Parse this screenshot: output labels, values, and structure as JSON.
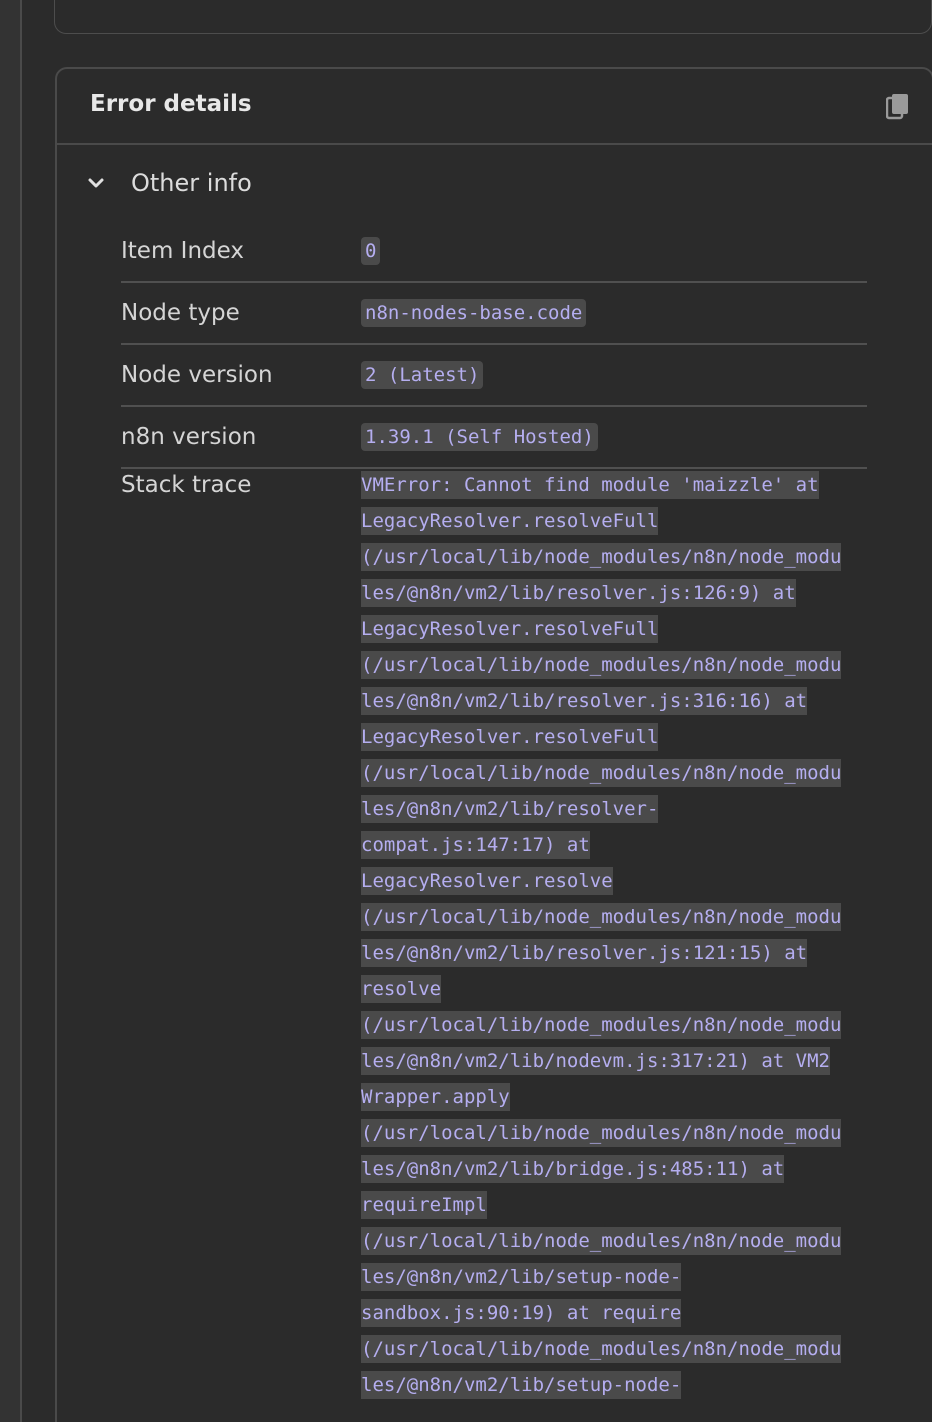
{
  "panel": {
    "title": "Error details",
    "copy_icon": "copy-icon",
    "section": {
      "label": "Other info",
      "chevron_icon": "chevron-down-icon"
    },
    "rows": [
      {
        "key": "Item Index",
        "value": "0"
      },
      {
        "key": "Node type",
        "value": "n8n-nodes-base.code"
      },
      {
        "key": "Node version",
        "value": "2 (Latest)"
      },
      {
        "key": "n8n version",
        "value": "1.39.1 (Self Hosted)"
      }
    ],
    "stack_label": "Stack trace",
    "stack_lines": [
      "VMError: Cannot find module 'maizzle' at",
      "LegacyResolver.resolveFull",
      "(/usr/local/lib/node_modules/n8n/node_modu",
      "les/@n8n/vm2/lib/resolver.js:126:9) at",
      "LegacyResolver.resolveFull",
      "(/usr/local/lib/node_modules/n8n/node_modu",
      "les/@n8n/vm2/lib/resolver.js:316:16) at",
      "LegacyResolver.resolveFull",
      "(/usr/local/lib/node_modules/n8n/node_modu",
      "les/@n8n/vm2/lib/resolver-",
      "compat.js:147:17) at",
      "LegacyResolver.resolve",
      "(/usr/local/lib/node_modules/n8n/node_modu",
      "les/@n8n/vm2/lib/resolver.js:121:15) at",
      "resolve",
      "(/usr/local/lib/node_modules/n8n/node_modu",
      "les/@n8n/vm2/lib/nodevm.js:317:21) at VM2",
      "Wrapper.apply",
      "(/usr/local/lib/node_modules/n8n/node_modu",
      "les/@n8n/vm2/lib/bridge.js:485:11) at",
      "requireImpl",
      "(/usr/local/lib/node_modules/n8n/node_modu",
      "les/@n8n/vm2/lib/setup-node-",
      "sandbox.js:90:19) at require",
      "(/usr/local/lib/node_modules/n8n/node_modu",
      "les/@n8n/vm2/lib/setup-node-"
    ]
  }
}
